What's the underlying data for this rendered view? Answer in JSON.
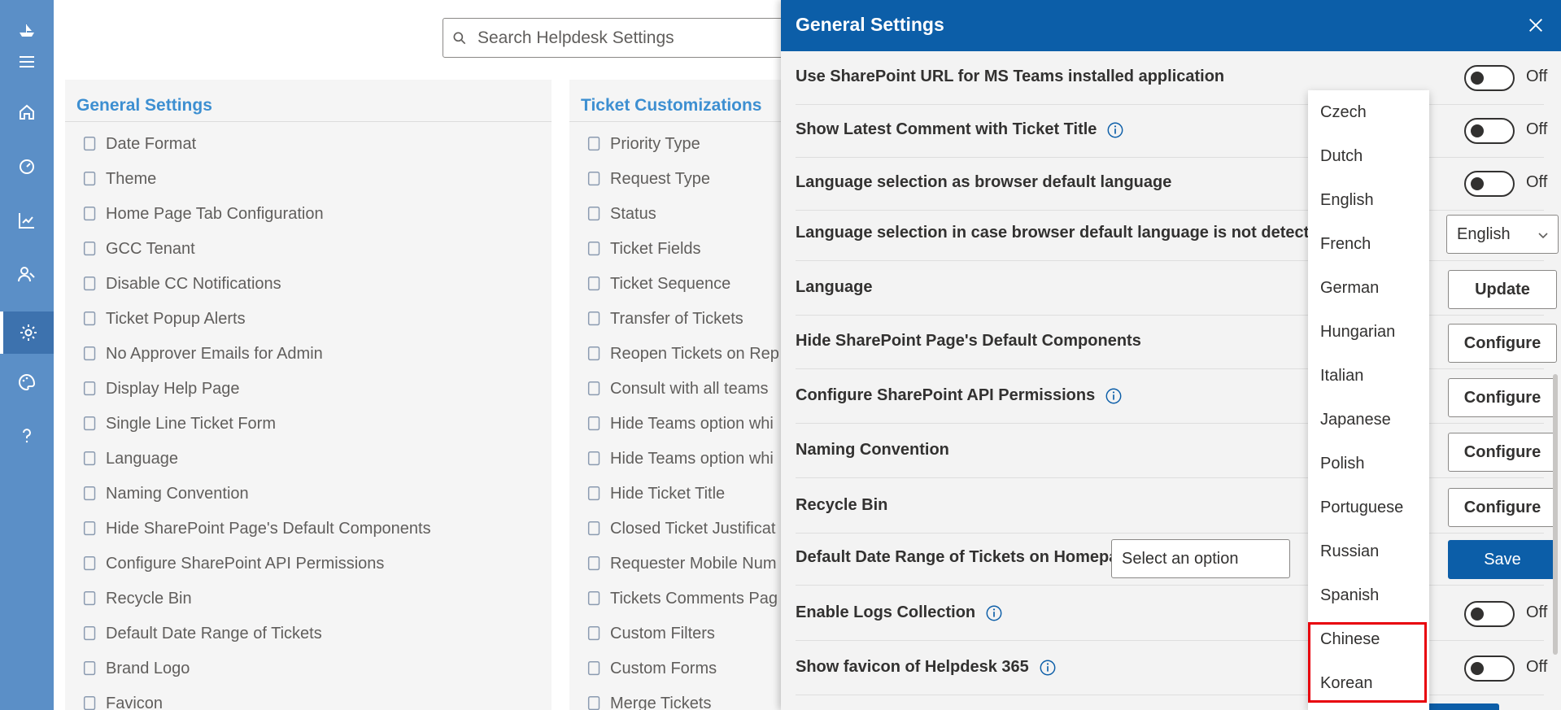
{
  "search": {
    "placeholder": "Search Helpdesk Settings",
    "icon": "search-icon"
  },
  "sidebar": {
    "items": [
      {
        "icon": "boat-logo-icon"
      },
      {
        "icon": "hamburger-icon"
      },
      {
        "icon": "home-icon"
      },
      {
        "icon": "dashboard-icon"
      },
      {
        "icon": "reports-icon"
      },
      {
        "icon": "users-icon"
      },
      {
        "icon": "settings-icon",
        "active": true
      },
      {
        "icon": "palette-icon"
      },
      {
        "icon": "help-icon"
      }
    ]
  },
  "general_settings": {
    "title": "General Settings",
    "items": [
      "Date Format",
      "Theme",
      "Home Page Tab Configuration",
      "GCC Tenant",
      "Disable CC Notifications",
      "Ticket Popup Alerts",
      "No Approver Emails for Admin",
      "Display Help Page",
      "Single Line Ticket Form",
      "Language",
      "Naming Convention",
      "Hide SharePoint Page's Default Components",
      "Configure SharePoint API Permissions",
      "Recycle Bin",
      "Default Date Range of Tickets",
      "Brand Logo",
      "Favicon"
    ]
  },
  "ticket_customizations": {
    "title": "Ticket Customizations",
    "items": [
      "Priority Type",
      "Request Type",
      "Status",
      "Ticket Fields",
      "Ticket Sequence",
      "Transfer of Tickets",
      "Reopen Tickets on Rep",
      "Consult with all teams",
      "Hide Teams option whi",
      "Hide Teams option whi",
      "Hide Ticket Title",
      "Closed Ticket Justificat",
      "Requester Mobile Num",
      "Tickets Comments Pag",
      "Custom Filters",
      "Custom Forms",
      "Merge Tickets"
    ]
  },
  "panel": {
    "title": "General Settings",
    "close_icon": "close-icon",
    "rows": [
      {
        "label": "Use SharePoint URL for MS Teams installed application",
        "control": "toggle",
        "value": "Off",
        "info": false
      },
      {
        "label": "Show Latest Comment with Ticket Title",
        "control": "toggle",
        "value": "Off",
        "info": true
      },
      {
        "label": "Language selection as browser default language",
        "control": "toggle",
        "value": "Off",
        "info": false
      },
      {
        "label": "Language selection in case browser default language is not detected",
        "control": "select",
        "value": "English",
        "info": false
      },
      {
        "label": "Language",
        "control": "button",
        "value": "Update",
        "info": false
      },
      {
        "label": "Hide SharePoint Page's Default Components",
        "control": "button",
        "value": "Configure",
        "info": false
      },
      {
        "label": "Configure SharePoint API Permissions",
        "control": "button",
        "value": "Configure",
        "info": true
      },
      {
        "label": "Naming Convention",
        "control": "button",
        "value": "Configure",
        "info": false
      },
      {
        "label": "Recycle Bin",
        "control": "button",
        "value": "Configure",
        "info": false
      },
      {
        "label": "Default Date Range of Tickets on Homepage",
        "control": "select_save",
        "placeholder": "Select an option",
        "value": "Save",
        "info": false
      },
      {
        "label": "Enable Logs Collection",
        "control": "toggle",
        "value": "Off",
        "info": true
      },
      {
        "label": "Show favicon of Helpdesk 365",
        "control": "toggle",
        "value": "Off",
        "info": true
      }
    ]
  },
  "language_dropdown": {
    "options": [
      "Czech",
      "Dutch",
      "English",
      "French",
      "German",
      "Hungarian",
      "Italian",
      "Japanese",
      "Polish",
      "Portuguese",
      "Russian",
      "Spanish",
      "Chinese",
      "Korean"
    ],
    "highlighted": [
      "Chinese",
      "Korean"
    ],
    "highlight_color": "#e8000b"
  },
  "colors": {
    "rail": "#5b8fc7",
    "header": "#0c5ea8",
    "category_title": "#3d8fd1",
    "primary_button": "#0c5ea8"
  }
}
